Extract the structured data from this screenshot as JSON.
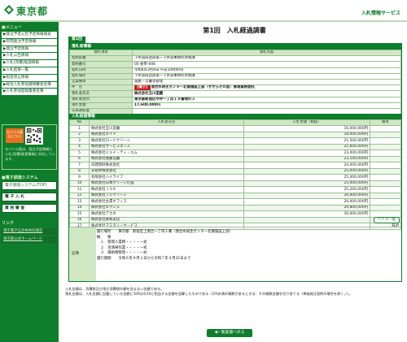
{
  "header": {
    "logo_text": "東京都",
    "service_name": "入札情報サービス"
  },
  "sidebar": {
    "menu_heading": "■メニュー",
    "menu_items": [
      {
        "label": "▶発注予定公告予定情報検索",
        "icon": "arrow-right-icon"
      },
      {
        "label": "▶年間発注予定情報",
        "icon": "arrow-right-icon"
      },
      {
        "label": "▶発注予定情報",
        "icon": "arrow-right-icon"
      },
      {
        "label": "▶入札公告情報",
        "icon": "arrow-right-icon"
      },
      {
        "label": "▶入札(見積)経過情報",
        "icon": "arrow-right-icon"
      },
      {
        "label": "▶入札結果一覧",
        "icon": "arrow-right-icon"
      },
      {
        "label": "▶指名停止情報",
        "icon": "arrow-right-icon"
      },
      {
        "label": "▶総合入札参加資格審査名簿",
        "icon": "arrow-right-icon"
      },
      {
        "label": "▶入札参加登録業者名簿",
        "icon": "arrow-right-icon"
      }
    ],
    "mobile": {
      "badge": "モバイル版はこちら",
      "note": "モバイル版は、発注予定情報と入札(見積)経過情報に対応しています。"
    },
    "system_heading": "■電子調達システム",
    "system_buttons": [
      {
        "label": "電子調達システム(TOP)"
      },
      {
        "label": "電 子 入 札"
      },
      {
        "label": "資 格 審 査"
      }
    ],
    "links_heading": "リンク",
    "links": [
      {
        "label": "東京電子自治体共同運営"
      },
      {
        "label": "東京都公式ホームページ"
      }
    ]
  },
  "main": {
    "title": "第1回　入札経過調書",
    "round_tab": "第1回",
    "info_heading": "落札者情報",
    "info_col_item": "落札項目",
    "info_col_content": "落札内容",
    "info_rows": [
      {
        "key": "契約部署",
        "value": "下水道局西部第一下水道事務所庶務課"
      },
      {
        "key": "契約番号",
        "value": "05-委単-006"
      },
      {
        "key": "開札日時",
        "value": "令和6年3月4日 午前10時00分"
      },
      {
        "key": "開札場所",
        "value": "下水道局西部第一下水道事務所庶務課"
      },
      {
        "key": "営業種目",
        "value": "道路・公園等管理"
      },
      {
        "key": "件　名",
        "value": "落合水再生センター北側施設上部（せせらぎの里）管理業務委託",
        "ticket": "【電子】"
      },
      {
        "key": "落札者氏名",
        "value": "株式会社玉川造園"
      },
      {
        "key": "落札者住所",
        "value": "東京都新宿区中井一丁目１９番地の３"
      },
      {
        "key": "落札金額",
        "value": "17,600,000円"
      },
      {
        "key": "公表通知書",
        "value": ""
      }
    ],
    "bid_heading": "入札経過情報",
    "bid_columns": {
      "no": "No",
      "name": "入札者氏名",
      "amount": "入札金額（税抜）",
      "note": "備考"
    },
    "bids": [
      {
        "no": "1",
        "name": "株式会社玉川造園",
        "amount": "16,000,000円",
        "note": ""
      },
      {
        "no": "2",
        "name": "株式会社エイト",
        "amount": "18,000,000円",
        "note": ""
      },
      {
        "no": "3",
        "name": "株式会社ロードクリーン",
        "amount": "21,500,000円",
        "note": ""
      },
      {
        "no": "4",
        "name": "株式会社サービスエース",
        "amount": "21,600,000円",
        "note": ""
      },
      {
        "no": "5",
        "name": "株式会社ジェイ・ティ・エム",
        "amount": "23,000,000円",
        "note": ""
      },
      {
        "no": "6",
        "name": "株式会社後藤造園",
        "amount": "23,100,000円",
        "note": ""
      },
      {
        "no": "7",
        "name": "日建管財株式会社",
        "amount": "24,000,000円",
        "note": ""
      },
      {
        "no": "8",
        "name": "光管財株式会社",
        "amount": "25,000,000円",
        "note": ""
      },
      {
        "no": "9",
        "name": "有限会社ハイライフ",
        "amount": "25,000,000円",
        "note": ""
      },
      {
        "no": "10",
        "name": "株式会社日本グリーン企画",
        "amount": "25,000,000円",
        "note": ""
      },
      {
        "no": "11",
        "name": "株式会社ＪＳＫ",
        "amount": "25,200,000円",
        "note": ""
      },
      {
        "no": "12",
        "name": "株式会社フジクリーン",
        "amount": "26,000,000円",
        "note": ""
      },
      {
        "no": "13",
        "name": "株式会社古澤オフィス",
        "amount": "26,000,000円",
        "note": ""
      },
      {
        "no": "14",
        "name": "株式会社エクシズ",
        "amount": "29,800,000円",
        "note": ""
      },
      {
        "no": "15",
        "name": "株式会社アカネ",
        "amount": "30,000,000円",
        "note": ""
      },
      {
        "no": "16",
        "name": "株式会社東和美化",
        "amount": "",
        "note": "辞退"
      },
      {
        "no": "17",
        "name": "株式会社マスタリーサービス",
        "amount": "",
        "note": "辞退"
      }
    ],
    "history_button": "ハイル一覧",
    "memo_key": "記事",
    "memo_lines": [
      "履行場所　　東京都　新宿区上落合一丁目１番（落合水再生センター北側施設上部）",
      "概　　要",
      "　１　管理人業務・・・・一式",
      "　２　池清掃作業・・・・一式",
      "　３　補助物管理・・・・一式",
      "履行期間　　令和６年４月１日から令和７年３月31日まで"
    ],
    "footnotes": [
      "入札金額は、消費税及び地方消費税の額を含まない金額である。",
      "落札金額は、入札金額に記載している金額に100分の10に相当する金額を加算したものである（1円未満の端数があるときは、その端数金額を切り捨てる（単価発注契約の場合を除く。））。"
    ],
    "back_button": "◀一覧画面へ戻る"
  },
  "colors": {
    "brand_green": "#0e7d2c",
    "light_green": "#cfe8c3",
    "ticket_red": "#c81f1f"
  }
}
